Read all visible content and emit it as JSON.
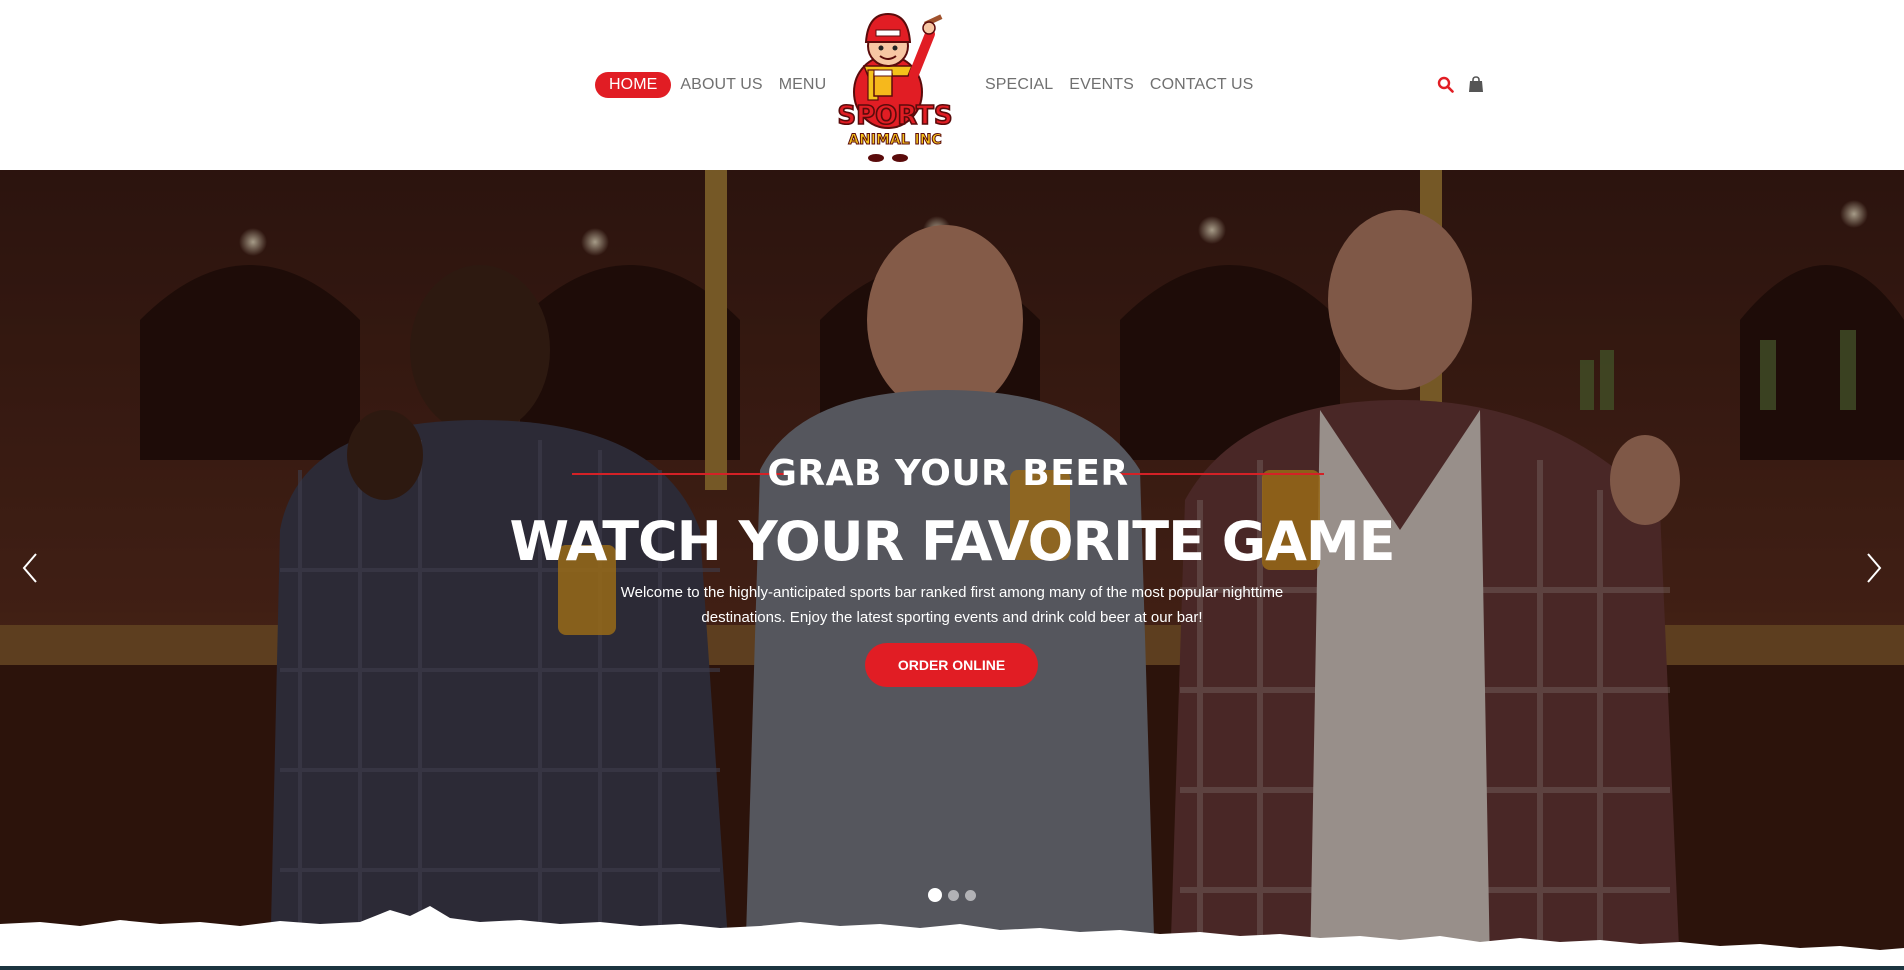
{
  "nav": {
    "left_items": [
      {
        "label": "HOME",
        "active": true
      },
      {
        "label": "ABOUT US",
        "active": false
      },
      {
        "label": "MENU",
        "active": false
      }
    ],
    "right_items": [
      {
        "label": "SPECIAL",
        "active": false
      },
      {
        "label": "EVENTS",
        "active": false
      },
      {
        "label": "CONTACT US",
        "active": false
      }
    ],
    "accent_color": "#e11d24",
    "text_color": "#707070"
  },
  "logo": {
    "line1": "SPORTS",
    "line2": "ANIMAL INC",
    "icon": "cartoon-mascot-logo"
  },
  "header_icons": [
    {
      "name": "search-icon",
      "color": "#e11d24"
    },
    {
      "name": "shopping-bag-icon",
      "color": "#555555"
    }
  ],
  "hero": {
    "kicker": "GRAB YOUR BEER",
    "headline": "WATCH YOUR FAVORITE GAME",
    "description": "Welcome to the highly-anticipated sports bar ranked first among many of the most popular nighttime destinations. Enjoy the latest sporting events and drink cold beer at our bar!",
    "cta_label": "ORDER ONLINE",
    "slides_total": 3,
    "active_slide": 1,
    "prev_icon": "chevron-left-icon",
    "next_icon": "chevron-right-icon"
  }
}
